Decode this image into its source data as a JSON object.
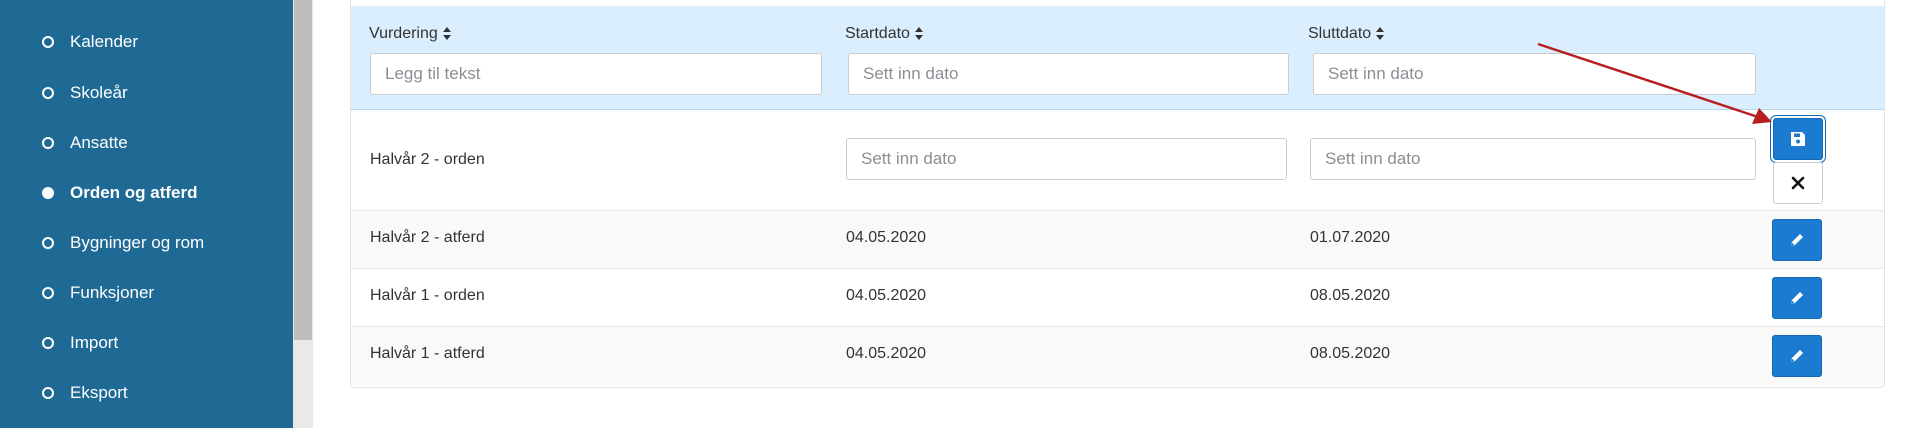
{
  "sidebar": {
    "items": [
      {
        "label": "Kalender",
        "active": false
      },
      {
        "label": "Skoleår",
        "active": false
      },
      {
        "label": "Ansatte",
        "active": false
      },
      {
        "label": "Orden og atferd",
        "active": true
      },
      {
        "label": "Bygninger og rom",
        "active": false
      },
      {
        "label": "Funksjoner",
        "active": false
      },
      {
        "label": "Import",
        "active": false
      },
      {
        "label": "Eksport",
        "active": false
      }
    ]
  },
  "table": {
    "columns": {
      "vurdering": "Vurdering",
      "startdato": "Startdato",
      "sluttdato": "Sluttdato"
    },
    "filters": {
      "vurdering_placeholder": "Legg til tekst",
      "startdato_placeholder": "Sett inn dato",
      "sluttdato_placeholder": "Sett inn dato"
    },
    "editing_row": {
      "vurdering": "Halvår 2 - orden",
      "startdato_placeholder": "Sett inn dato",
      "sluttdato_placeholder": "Sett inn dato",
      "save_icon": "floppy-disk-icon",
      "cancel_icon": "close-icon"
    },
    "rows": [
      {
        "vurdering": "Halvår 2 - atferd",
        "startdato": "04.05.2020",
        "sluttdato": "01.07.2020"
      },
      {
        "vurdering": "Halvår 1 - orden",
        "startdato": "04.05.2020",
        "sluttdato": "08.05.2020"
      },
      {
        "vurdering": "Halvår 1 - atferd",
        "startdato": "04.05.2020",
        "sluttdato": "08.05.2020"
      }
    ],
    "edit_icon": "pencil-icon"
  },
  "colors": {
    "sidebar": "#1f6a95",
    "header": "#dbeefd",
    "primary_button": "#1a7bd0",
    "arrow": "#b81e1e"
  }
}
